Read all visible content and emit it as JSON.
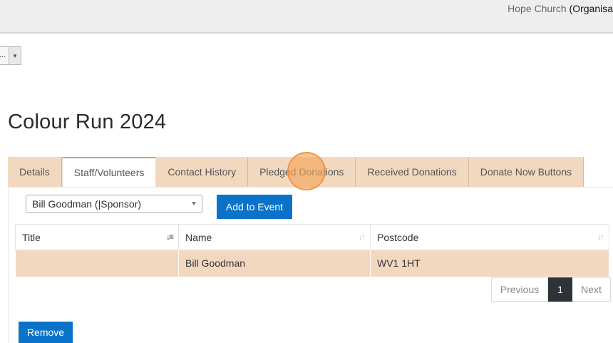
{
  "header": {
    "org_name": "Hope Church",
    "org_suffix": "(Organisa"
  },
  "filter": {
    "value": "..."
  },
  "page": {
    "title": "Colour Run 2024"
  },
  "tabs": [
    {
      "label": "Details"
    },
    {
      "label": "Staff/Volunteers"
    },
    {
      "label": "Contact History"
    },
    {
      "label": "Pledged Donations"
    },
    {
      "label": "Received Donations"
    },
    {
      "label": "Donate Now Buttons"
    }
  ],
  "active_tab": "Staff/Volunteers",
  "staff": {
    "select_value": "Bill Goodman (|Sponsor)",
    "add_label": "Add to Event",
    "remove_label": "Remove"
  },
  "table": {
    "columns": [
      {
        "label": "Title",
        "sort_icon": "sort-desc-icon"
      },
      {
        "label": "Name",
        "sort_icon": "sort-icon"
      },
      {
        "label": "Postcode",
        "sort_icon": "sort-icon"
      }
    ],
    "rows": [
      {
        "title": "",
        "name": "Bill Goodman",
        "postcode": "WV1 1HT"
      }
    ]
  },
  "pagination": {
    "previous": "Previous",
    "current": "1",
    "next": "Next"
  },
  "colors": {
    "accent": "#0a73c9",
    "tab_bg": "#f3d8c0",
    "pager_active": "#2d3339"
  }
}
